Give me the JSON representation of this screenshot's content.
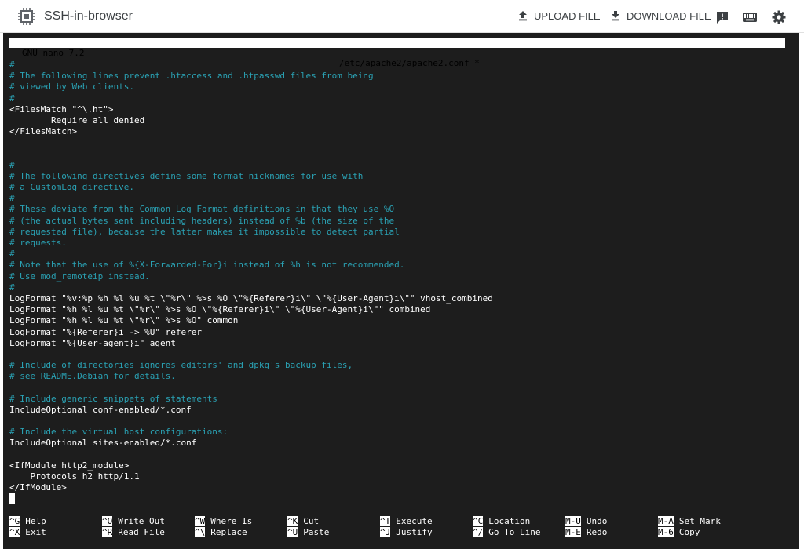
{
  "app": {
    "title": "SSH-in-browser",
    "upload_label": "UPLOAD FILE",
    "download_label": "DOWNLOAD FILE",
    "icons": [
      "chip-logo-icon",
      "upload-icon",
      "download-icon",
      "feedback-icon",
      "keyboard-icon",
      "gear-icon"
    ]
  },
  "nano": {
    "version": "GNU nano 7.2",
    "file": "/etc/apache2/apache2.conf *"
  },
  "lines": [
    {
      "text": "#",
      "type": "comment"
    },
    {
      "text": "# The following lines prevent .htaccess and .htpasswd files from being",
      "type": "comment"
    },
    {
      "text": "# viewed by Web clients.",
      "type": "comment"
    },
    {
      "text": "#",
      "type": "comment"
    },
    {
      "text": "<FilesMatch \"^\\.ht\">",
      "type": "code"
    },
    {
      "text": "        Require all denied",
      "type": "code"
    },
    {
      "text": "</FilesMatch>",
      "type": "code"
    },
    {
      "text": "",
      "type": "code"
    },
    {
      "text": "",
      "type": "code"
    },
    {
      "text": "#",
      "type": "comment"
    },
    {
      "text": "# The following directives define some format nicknames for use with",
      "type": "comment"
    },
    {
      "text": "# a CustomLog directive.",
      "type": "comment"
    },
    {
      "text": "#",
      "type": "comment"
    },
    {
      "text": "# These deviate from the Common Log Format definitions in that they use %O",
      "type": "comment"
    },
    {
      "text": "# (the actual bytes sent including headers) instead of %b (the size of the",
      "type": "comment"
    },
    {
      "text": "# requested file), because the latter makes it impossible to detect partial",
      "type": "comment"
    },
    {
      "text": "# requests.",
      "type": "comment"
    },
    {
      "text": "#",
      "type": "comment"
    },
    {
      "text": "# Note that the use of %{X-Forwarded-For}i instead of %h is not recommended.",
      "type": "comment"
    },
    {
      "text": "# Use mod_remoteip instead.",
      "type": "comment"
    },
    {
      "text": "#",
      "type": "comment"
    },
    {
      "text": "LogFormat \"%v:%p %h %l %u %t \\\"%r\\\" %>s %O \\\"%{Referer}i\\\" \\\"%{User-Agent}i\\\"\" vhost_combined",
      "type": "code"
    },
    {
      "text": "LogFormat \"%h %l %u %t \\\"%r\\\" %>s %O \\\"%{Referer}i\\\" \\\"%{User-Agent}i\\\"\" combined",
      "type": "code"
    },
    {
      "text": "LogFormat \"%h %l %u %t \\\"%r\\\" %>s %O\" common",
      "type": "code"
    },
    {
      "text": "LogFormat \"%{Referer}i -> %U\" referer",
      "type": "code"
    },
    {
      "text": "LogFormat \"%{User-agent}i\" agent",
      "type": "code"
    },
    {
      "text": "",
      "type": "code"
    },
    {
      "text": "# Include of directories ignores editors' and dpkg's backup files,",
      "type": "comment"
    },
    {
      "text": "# see README.Debian for details.",
      "type": "comment"
    },
    {
      "text": "",
      "type": "code"
    },
    {
      "text": "# Include generic snippets of statements",
      "type": "comment"
    },
    {
      "text": "IncludeOptional conf-enabled/*.conf",
      "type": "code"
    },
    {
      "text": "",
      "type": "code"
    },
    {
      "text": "# Include the virtual host configurations:",
      "type": "comment"
    },
    {
      "text": "IncludeOptional sites-enabled/*.conf",
      "type": "code"
    },
    {
      "text": "",
      "type": "code"
    },
    {
      "text": "<IfModule http2_module>",
      "type": "code"
    },
    {
      "text": "    Protocols h2 http/1.1",
      "type": "code"
    },
    {
      "text": "</IfModule>",
      "type": "code"
    },
    {
      "text": "",
      "type": "cursor"
    }
  ],
  "shortcuts": [
    {
      "key": "^G",
      "label": "Help"
    },
    {
      "key": "^X",
      "label": "Exit"
    },
    {
      "key": "^O",
      "label": "Write Out"
    },
    {
      "key": "^R",
      "label": "Read File"
    },
    {
      "key": "^W",
      "label": "Where Is"
    },
    {
      "key": "^\\",
      "label": "Replace"
    },
    {
      "key": "^K",
      "label": "Cut"
    },
    {
      "key": "^U",
      "label": "Paste"
    },
    {
      "key": "^T",
      "label": "Execute"
    },
    {
      "key": "^J",
      "label": "Justify"
    },
    {
      "key": "^C",
      "label": "Location"
    },
    {
      "key": "^/",
      "label": "Go To Line"
    },
    {
      "key": "M-U",
      "label": "Undo"
    },
    {
      "key": "M-E",
      "label": "Redo"
    },
    {
      "key": "M-A",
      "label": "Set Mark"
    },
    {
      "key": "M-6",
      "label": "Copy"
    }
  ]
}
